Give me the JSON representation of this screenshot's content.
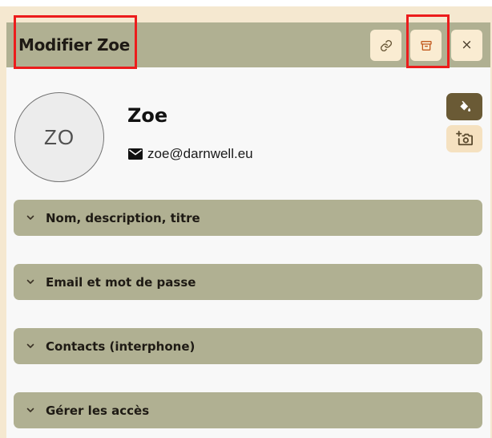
{
  "dialog": {
    "title": "Modifier Zoe",
    "header_actions": [
      {
        "name": "link",
        "icon": "link-icon"
      },
      {
        "name": "archive",
        "icon": "archive-icon"
      },
      {
        "name": "close",
        "label": "×",
        "icon": "close-icon"
      }
    ]
  },
  "profile": {
    "initials": "ZO",
    "name": "Zoe",
    "email": "zoe@darnwell.eu",
    "email_icon": "mail-icon",
    "side_actions": [
      {
        "name": "color",
        "icon": "paint-bucket-icon"
      },
      {
        "name": "photo",
        "icon": "add-photo-icon"
      }
    ]
  },
  "sections": [
    {
      "label": "Nom, description, titre"
    },
    {
      "label": "Email et mot de passe"
    },
    {
      "label": "Contacts (interphone)"
    },
    {
      "label": "Gérer les accès"
    }
  ],
  "colors": {
    "header_bg": "#b0b092",
    "button_bg": "#faecd2",
    "paint_button_bg": "#6a5a35",
    "photo_button_bg": "#f5e1c0",
    "highlight": "#ec1c1c",
    "panel_bg": "#f8f8f8",
    "backdrop": "#f5e8d0"
  }
}
